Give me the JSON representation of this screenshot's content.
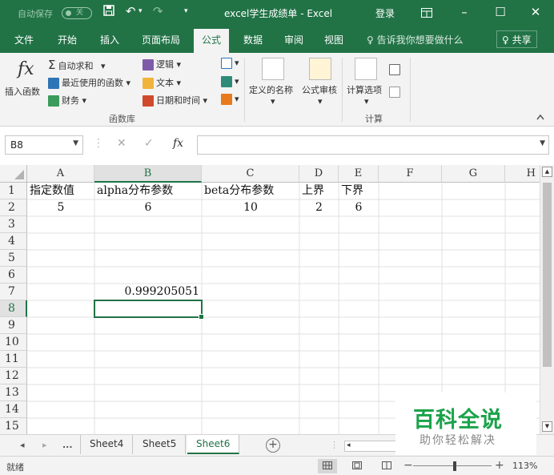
{
  "titlebar": {
    "autosave_label": "自动保存",
    "autosave_state": "关",
    "save_icon": "save-icon",
    "undo_icon": "undo-icon",
    "redo_icon": "redo-icon",
    "title": "excel学生成绩单  -  Excel",
    "login": "登录",
    "ribbon_display_icon": "ribbon-display-icon",
    "minimize": "–",
    "maximize": "☐",
    "close": "✕"
  },
  "tabs": [
    "文件",
    "开始",
    "插入",
    "页面布局",
    "公式",
    "数据",
    "审阅",
    "视图"
  ],
  "active_tab": "公式",
  "tell_me": "♀ 告诉我你想要做什么",
  "share": "♀ 共享",
  "ribbon": {
    "insert_function": "插入函数",
    "fx_symbol": "fx",
    "autosum": "自动求和",
    "recently_used": "最近使用的函数",
    "financial": "财务",
    "logical": "逻辑",
    "text": "文本",
    "date_time": "日期和时间",
    "group_function_library": "函数库",
    "defined_names": "定义的名称",
    "formula_auditing": "公式审核",
    "calc_options": "计算选项",
    "group_calculation": "计算",
    "dropdown_arrow": "▾",
    "sigma": "Σ"
  },
  "formula_bar": {
    "name_box": "B8",
    "cancel": "✕",
    "enter": "✓",
    "fx": "fx",
    "formula": ""
  },
  "columns": [
    "A",
    "B",
    "C",
    "D",
    "E",
    "F",
    "G",
    "H"
  ],
  "selected_column": "B",
  "rows": [
    "1",
    "2",
    "3",
    "4",
    "5",
    "6",
    "7",
    "8",
    "9",
    "10",
    "11",
    "12",
    "13",
    "14",
    "15"
  ],
  "selected_row": "8",
  "cells": {
    "A1": "指定数值",
    "B1": "alpha分布参数",
    "C1": "beta分布参数",
    "D1": "上界",
    "E1": "下界",
    "A2": "5",
    "B2": "6",
    "C2": "10",
    "D2": "2",
    "E2": "6",
    "B7": "0.999205051"
  },
  "sheets": [
    "Sheet4",
    "Sheet5",
    "Sheet6"
  ],
  "active_sheet": "Sheet6",
  "sheet_nav": {
    "prev": "◂",
    "next": "▸",
    "more": "..."
  },
  "add_sheet": "+",
  "watermark": {
    "title": "百科全说",
    "subtitle": "助你轻松解决"
  },
  "status": {
    "ready": "就绪",
    "zoom": "113%",
    "zoom_minus": "−",
    "zoom_plus": "+",
    "zoom_fraction": 0.51
  },
  "colors": {
    "excel_green": "#217346",
    "watermark_green": "#1aa34a"
  }
}
